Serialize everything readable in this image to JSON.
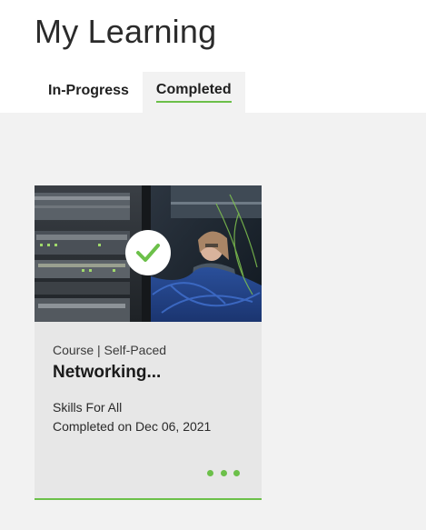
{
  "page": {
    "title": "My Learning"
  },
  "tabs": [
    {
      "label": "In-Progress",
      "active": false
    },
    {
      "label": "Completed",
      "active": true
    }
  ],
  "card": {
    "meta": "Course | Self-Paced",
    "title": "Networking...",
    "provider": "Skills For All",
    "completed": "Completed on Dec 06, 2021",
    "status_icon": "check-circle-icon",
    "menu_icon": "more-dots-icon"
  },
  "colors": {
    "accent": "#6cc04a",
    "content_bg": "#f2f2f2",
    "card_bg": "#e7e7e7"
  }
}
